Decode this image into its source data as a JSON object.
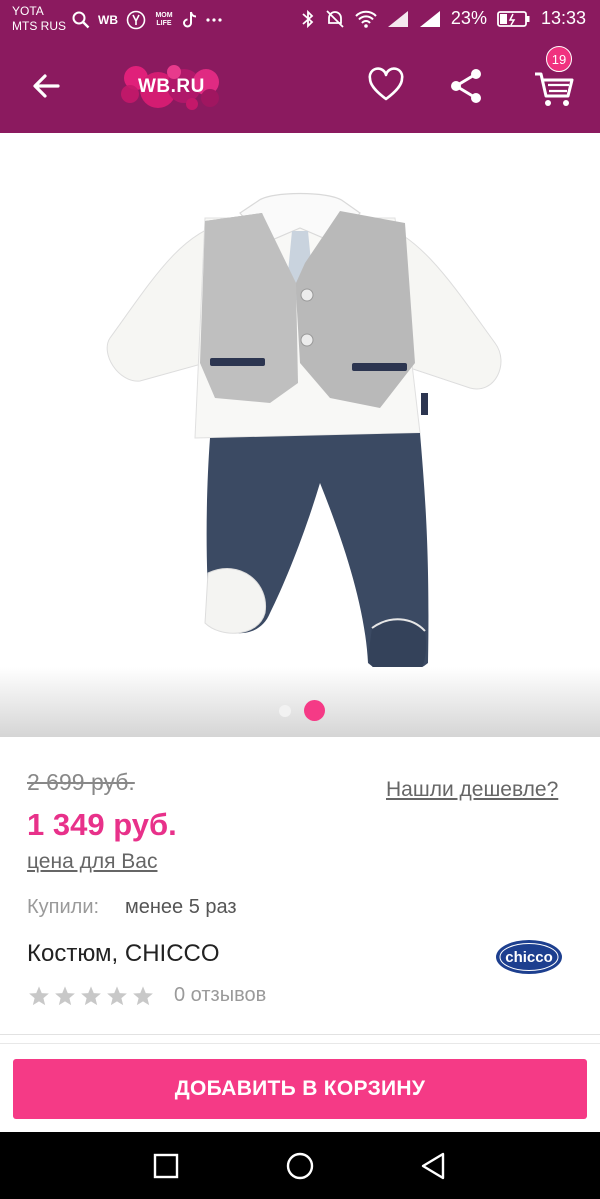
{
  "status_bar": {
    "carrier_line1": "YOTA",
    "carrier_line2": "MTS RUS",
    "left_icons": [
      "search-icon",
      "wb-icon",
      "yandex-icon",
      "momlife-icon",
      "tiktok-icon",
      "more-icon"
    ],
    "wb_label": "WB",
    "momlife_label": "MOM LIFE",
    "battery": "23%",
    "time": "13:33"
  },
  "app_bar": {
    "logo_text": "WB.RU",
    "cart_count": "19",
    "colors": {
      "background": "#8b1a5f",
      "badge": "#f0327f"
    }
  },
  "gallery": {
    "image": "baby-suit-photo",
    "dots": 2,
    "active_dot": 2
  },
  "product": {
    "old_price": "2 699 руб.",
    "cheaper_link": "Нашли дешевле?",
    "new_price": "1 349 руб.",
    "price_for_you": "цена для Вас",
    "bought_label": "Купили:",
    "bought_value": "менее 5 раз",
    "title": "Костюм, CHICCO",
    "brand": "chicco",
    "rating": 0,
    "reviews": "0 отзывов"
  },
  "bottom": {
    "add_to_cart": "ДОБАВИТЬ В КОРЗИНУ",
    "button_color": "#f53a86"
  }
}
